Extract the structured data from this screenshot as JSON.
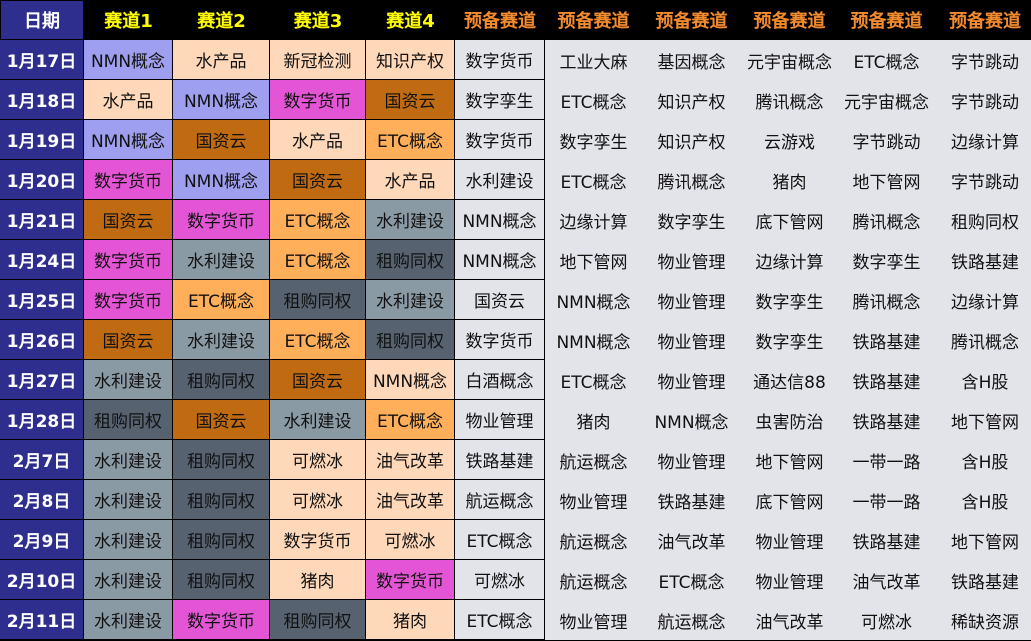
{
  "colors": {
    "nmn": "#9f9ff0",
    "water": "#fed8b8",
    "covid": "#fed8b8",
    "ip": "#fed8b8",
    "digital_currency": "#e455d6",
    "soe_cloud": "#c06a12",
    "etc": "#ffae59",
    "water_infra": "#8a9aa4",
    "lease": "#566270",
    "pig": "#fed8b8",
    "gas": "#fed8b8",
    "oil": "#fed8b8",
    "white_wine": "#e3e4ea",
    "default": "#fed8b8",
    "backup_bg": "#e3e4ea"
  },
  "headers": [
    "日期",
    "赛道1",
    "赛道2",
    "赛道3",
    "赛道4",
    "预备赛道",
    "预备赛道",
    "预备赛道",
    "预备赛道",
    "预备赛道",
    "预备赛道"
  ],
  "rows": [
    {
      "date": "1月17日",
      "tracks": [
        [
          "NMN概念",
          "#9f9ff0"
        ],
        [
          "水产品",
          "#fed8b8"
        ],
        [
          "新冠检测",
          "#fed8b8"
        ],
        [
          "知识产权",
          "#fed8b8"
        ]
      ],
      "backups": [
        "数字货币",
        "工业大麻",
        "基因概念",
        "元宇宙概念",
        "ETC概念",
        "字节跳动"
      ]
    },
    {
      "date": "1月18日",
      "tracks": [
        [
          "水产品",
          "#fed8b8"
        ],
        [
          "NMN概念",
          "#9f9ff0"
        ],
        [
          "数字货币",
          "#e455d6"
        ],
        [
          "国资云",
          "#c06a12"
        ]
      ],
      "backups": [
        "数字孪生",
        "ETC概念",
        "知识产权",
        "腾讯概念",
        "元宇宙概念",
        "字节跳动"
      ]
    },
    {
      "date": "1月19日",
      "tracks": [
        [
          "NMN概念",
          "#9f9ff0"
        ],
        [
          "国资云",
          "#c06a12"
        ],
        [
          "水产品",
          "#fed8b8"
        ],
        [
          "ETC概念",
          "#ffae59"
        ]
      ],
      "backups": [
        "数字货币",
        "数字孪生",
        "知识产权",
        "云游戏",
        "字节跳动",
        "边缘计算"
      ]
    },
    {
      "date": "1月20日",
      "tracks": [
        [
          "数字货币",
          "#e455d6"
        ],
        [
          "NMN概念",
          "#9f9ff0"
        ],
        [
          "国资云",
          "#c06a12"
        ],
        [
          "水产品",
          "#fed8b8"
        ]
      ],
      "backups": [
        "水利建设",
        "ETC概念",
        "腾讯概念",
        "猪肉",
        "地下管网",
        "字节跳动"
      ]
    },
    {
      "date": "1月21日",
      "tracks": [
        [
          "国资云",
          "#c06a12"
        ],
        [
          "数字货币",
          "#e455d6"
        ],
        [
          "ETC概念",
          "#ffae59"
        ],
        [
          "水利建设",
          "#8a9aa4"
        ]
      ],
      "backups": [
        "NMN概念",
        "边缘计算",
        "数字孪生",
        "底下管网",
        "腾讯概念",
        "租购同权"
      ]
    },
    {
      "date": "1月24日",
      "tracks": [
        [
          "数字货币",
          "#e455d6"
        ],
        [
          "水利建设",
          "#8a9aa4"
        ],
        [
          "ETC概念",
          "#ffae59"
        ],
        [
          "租购同权",
          "#566270"
        ]
      ],
      "backups": [
        "NMN概念",
        "地下管网",
        "物业管理",
        "边缘计算",
        "数字孪生",
        "铁路基建"
      ]
    },
    {
      "date": "1月25日",
      "tracks": [
        [
          "数字货币",
          "#e455d6"
        ],
        [
          "ETC概念",
          "#ffae59"
        ],
        [
          "租购同权",
          "#566270"
        ],
        [
          "水利建设",
          "#8a9aa4"
        ]
      ],
      "backups": [
        "国资云",
        "NMN概念",
        "物业管理",
        "数字孪生",
        "腾讯概念",
        "边缘计算"
      ]
    },
    {
      "date": "1月26日",
      "tracks": [
        [
          "国资云",
          "#c06a12"
        ],
        [
          "水利建设",
          "#8a9aa4"
        ],
        [
          "ETC概念",
          "#ffae59"
        ],
        [
          "租购同权",
          "#566270"
        ]
      ],
      "backups": [
        "数字货币",
        "NMN概念",
        "物业管理",
        "数字孪生",
        "铁路基建",
        "腾讯概念"
      ]
    },
    {
      "date": "1月27日",
      "tracks": [
        [
          "水利建设",
          "#8a9aa4"
        ],
        [
          "租购同权",
          "#566270"
        ],
        [
          "国资云",
          "#c06a12"
        ],
        [
          "NMN概念",
          "#fed8b8"
        ]
      ],
      "backups": [
        "白酒概念",
        "ETC概念",
        "物业管理",
        "通达信88",
        "铁路基建",
        "含H股"
      ]
    },
    {
      "date": "1月28日",
      "tracks": [
        [
          "租购同权",
          "#566270"
        ],
        [
          "国资云",
          "#c06a12"
        ],
        [
          "水利建设",
          "#8a9aa4"
        ],
        [
          "ETC概念",
          "#ffae59"
        ]
      ],
      "backups": [
        "物业管理",
        "猪肉",
        "NMN概念",
        "虫害防治",
        "铁路基建",
        "地下管网"
      ]
    },
    {
      "date": "2月7日",
      "tracks": [
        [
          "水利建设",
          "#8a9aa4"
        ],
        [
          "租购同权",
          "#566270"
        ],
        [
          "可燃冰",
          "#fed8b8"
        ],
        [
          "油气改革",
          "#fed8b8"
        ]
      ],
      "backups": [
        "铁路基建",
        "航运概念",
        "物业管理",
        "地下管网",
        "一带一路",
        "含H股"
      ]
    },
    {
      "date": "2月8日",
      "tracks": [
        [
          "水利建设",
          "#8a9aa4"
        ],
        [
          "租购同权",
          "#566270"
        ],
        [
          "可燃冰",
          "#fed8b8"
        ],
        [
          "油气改革",
          "#fed8b8"
        ]
      ],
      "backups": [
        "航运概念",
        "物业管理",
        "铁路基建",
        "底下管网",
        "一带一路",
        "含H股"
      ]
    },
    {
      "date": "2月9日",
      "tracks": [
        [
          "水利建设",
          "#8a9aa4"
        ],
        [
          "租购同权",
          "#566270"
        ],
        [
          "数字货币",
          "#fed8b8"
        ],
        [
          "可燃冰",
          "#fed8b8"
        ]
      ],
      "backups": [
        "ETC概念",
        "航运概念",
        "油气改革",
        "物业管理",
        "铁路基建",
        "地下管网"
      ]
    },
    {
      "date": "2月10日",
      "tracks": [
        [
          "水利建设",
          "#8a9aa4"
        ],
        [
          "租购同权",
          "#566270"
        ],
        [
          "猪肉",
          "#fed8b8"
        ],
        [
          "数字货币",
          "#e455d6"
        ]
      ],
      "backups": [
        "可燃冰",
        "航运概念",
        "ETC概念",
        "物业管理",
        "油气改革",
        "铁路基建"
      ]
    },
    {
      "date": "2月11日",
      "tracks": [
        [
          "水利建设",
          "#8a9aa4"
        ],
        [
          "数字货币",
          "#e455d6"
        ],
        [
          "租购同权",
          "#566270"
        ],
        [
          "猪肉",
          "#fed8b8"
        ]
      ],
      "backups": [
        "ETC概念",
        "物业管理",
        "航运概念",
        "油气改革",
        "可燃冰",
        "稀缺资源"
      ]
    }
  ]
}
